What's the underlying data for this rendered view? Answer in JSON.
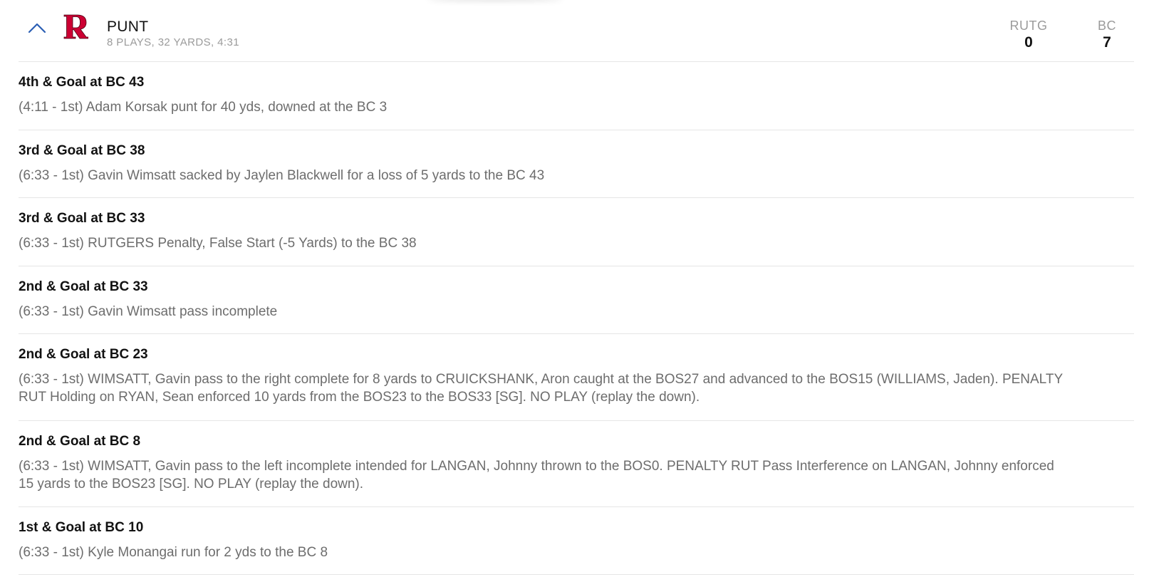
{
  "drive": {
    "result": "PUNT",
    "summary": "8 PLAYS, 32 YARDS, 4:31",
    "away": {
      "abbr": "RUTG",
      "score": "0"
    },
    "home": {
      "abbr": "BC",
      "score": "7"
    },
    "logo_color": "#cc0033",
    "accent_color": "#2b5fb4"
  },
  "plays": [
    {
      "situation": "4th & Goal at BC 43",
      "description": "(4:11 - 1st) Adam Korsak punt for 40 yds, downed at the BC 3"
    },
    {
      "situation": "3rd & Goal at BC 38",
      "description": "(6:33 - 1st) Gavin Wimsatt sacked by Jaylen Blackwell for a loss of 5 yards to the BC 43"
    },
    {
      "situation": "3rd & Goal at BC 33",
      "description": "(6:33 - 1st) RUTGERS Penalty, False Start (-5 Yards) to the BC 38"
    },
    {
      "situation": "2nd & Goal at BC 33",
      "description": "(6:33 - 1st) Gavin Wimsatt pass incomplete"
    },
    {
      "situation": "2nd & Goal at BC 23",
      "description": "(6:33 - 1st) WIMSATT, Gavin pass to the right complete for 8 yards to CRUICKSHANK, Aron caught at the BOS27 and advanced to the BOS15 (WILLIAMS, Jaden). PENALTY RUT Holding on RYAN, Sean enforced 10 yards from the BOS23 to the BOS33 [SG]. NO PLAY (replay the down)."
    },
    {
      "situation": "2nd & Goal at BC 8",
      "description": "(6:33 - 1st) WIMSATT, Gavin pass to the left incomplete intended for LANGAN, Johnny thrown to the BOS0. PENALTY RUT Pass Interference on LANGAN, Johnny enforced 15 yards to the BOS23 [SG]. NO PLAY (replay the down)."
    },
    {
      "situation": "1st & Goal at BC 10",
      "description": "(6:33 - 1st) Kyle Monangai run for 2 yds to the BC 8"
    }
  ]
}
